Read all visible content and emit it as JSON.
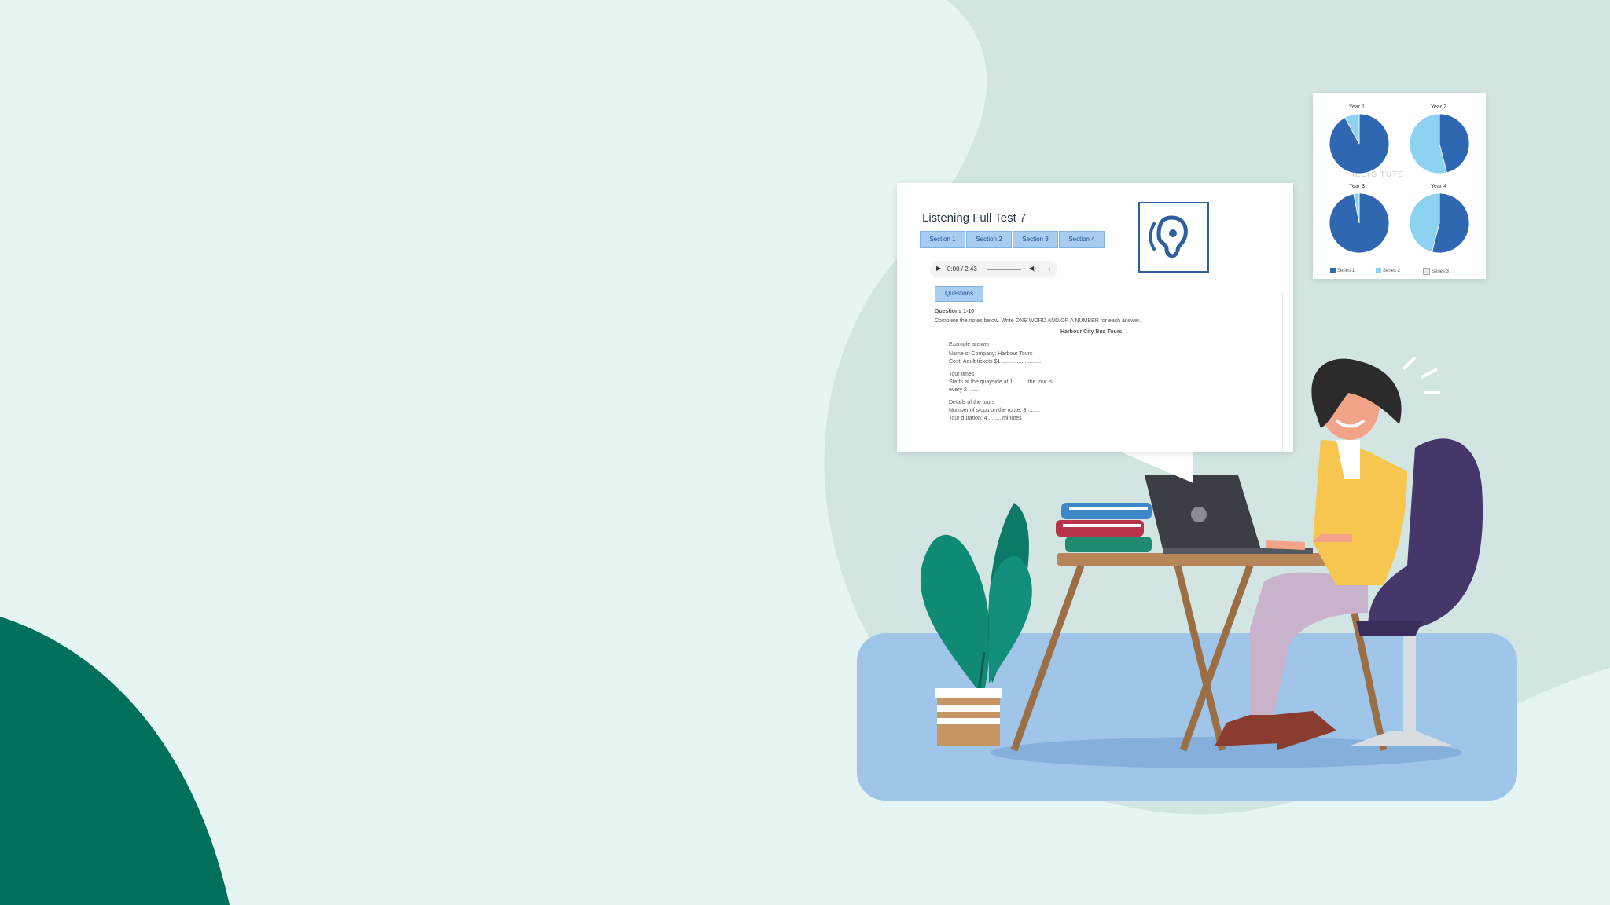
{
  "test_panel": {
    "title": "Listening Full Test 7",
    "tabs": [
      "Section 1",
      "Section 2",
      "Section 3",
      "Section 4"
    ],
    "audio_time": "0:00 / 2:43",
    "questions_button": "Questions",
    "lines": [
      "Questions 1-10",
      "Complete the notes below. Write ONE WORD AND/OR A NUMBER for each answer.",
      "Harbour City Bus Tours",
      "Example answer",
      "Name of Company: Harbour Tours",
      "Cost: Adult tickets $1 ..........................",
      "Tour times",
      "Starts at the quayside at 1 ........ the tour is",
      "every 2 ........",
      "Details of the tours",
      "Number of stops on the route: 3 ........",
      "Tour duration: 4 ........ minutes"
    ]
  },
  "pie_panel": {
    "watermark": "IELTS TUTS",
    "pies": [
      {
        "title": "Year 1",
        "values": [
          0.92,
          0.08
        ]
      },
      {
        "title": "Year 2",
        "values": [
          0.46,
          0.54
        ]
      },
      {
        "title": "Year 3",
        "values": [
          0.97,
          0.03
        ]
      },
      {
        "title": "Year 4",
        "values": [
          0.54,
          0.46
        ]
      }
    ],
    "legend": [
      "Series 1",
      "Series 2",
      "Series 3"
    ]
  },
  "colors": {
    "background": "#e6f4f4",
    "green_blob": "#006f5b",
    "floor": "#9fc5e8",
    "pie_dark": "#2f68b0",
    "pie_light": "#8dd2f0",
    "accent_tab": "#a8cdf0"
  }
}
